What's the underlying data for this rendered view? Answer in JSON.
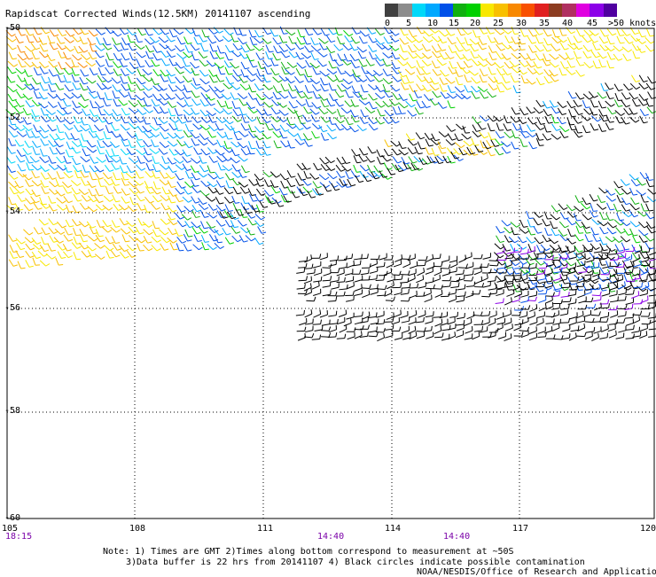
{
  "title": "Rapidscat Corrected Winds(12.5KM) 20141107 ascending",
  "legend": {
    "colors": [
      "#404040",
      "#8c8c8c",
      "#00d8f8",
      "#00a8ff",
      "#0050e8",
      "#10b010",
      "#00d000",
      "#f8e800",
      "#f8c000",
      "#f88800",
      "#f85000",
      "#e02020",
      "#8c3c20",
      "#b03060",
      "#e000e0",
      "#8c00e8",
      "#5000a0"
    ],
    "labels": [
      "0",
      "5",
      "10",
      "15",
      "20",
      "25",
      "30",
      "35",
      "40",
      "45",
      ">50 knots"
    ]
  },
  "axes": {
    "x_ticks": [
      "105",
      "108",
      "111",
      "114",
      "117",
      "120"
    ],
    "y_ticks": [
      "-50",
      "-52",
      "-54",
      "-56",
      "-58",
      "-60"
    ],
    "time_labels": [
      "18:15",
      "14:40",
      "14:40"
    ]
  },
  "notes": [
    "Note: 1) Times are GMT 2)Times along bottom correspond to measurement at ~50S",
    "3)Data buffer is 22 hrs from 20141107 4) Black circles indicate possible contamination",
    "NOAA/NESDIS/Office of Research and Applications"
  ]
}
